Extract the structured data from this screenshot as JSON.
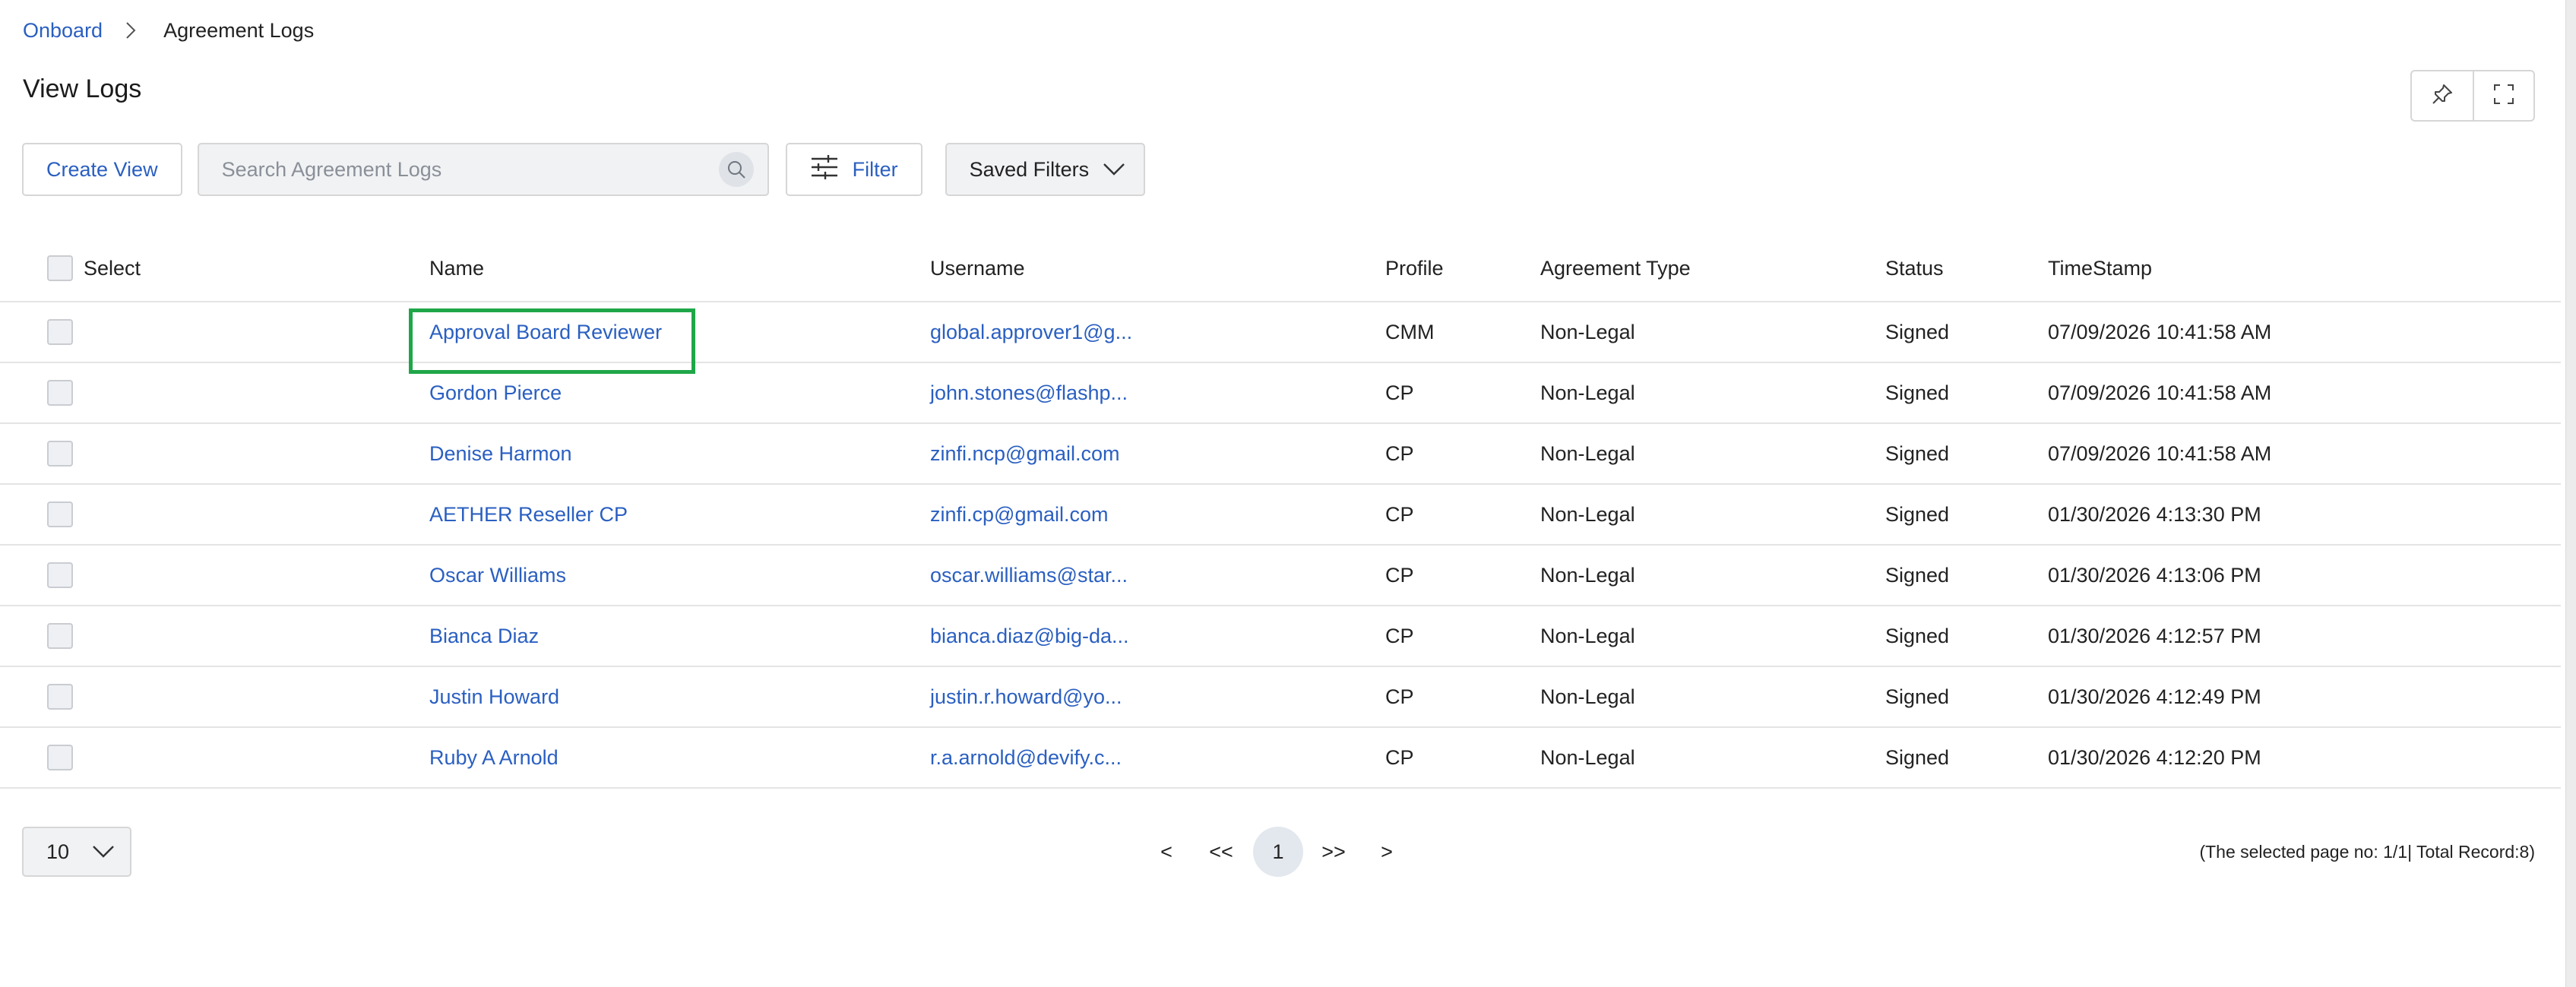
{
  "breadcrumb": {
    "parent": "Onboard",
    "current": "Agreement Logs"
  },
  "page_title": "View Logs",
  "toolbar": {
    "create_view": "Create View",
    "search_placeholder": "Search Agreement Logs",
    "filter": "Filter",
    "saved_filters": "Saved Filters"
  },
  "icons": {
    "pin": "pin-icon",
    "fullscreen": "fullscreen-icon",
    "search": "search-icon",
    "filter": "sliders-icon",
    "dropdown": "chevron-down-icon",
    "breadcrumb_separator": "chevron-right-icon"
  },
  "colors": {
    "link": "#2a5fc1",
    "highlight": "#1fa648"
  },
  "table": {
    "columns": {
      "select": "Select",
      "name": "Name",
      "username": "Username",
      "profile": "Profile",
      "agreement_type": "Agreement Type",
      "status": "Status",
      "timestamp": "TimeStamp"
    },
    "rows": [
      {
        "name": "Approval Board Reviewer",
        "username": "global.approver1@g...",
        "profile": "CMM",
        "agreement_type": "Non-Legal",
        "status": "Signed",
        "timestamp": "07/09/2026 10:41:58 AM"
      },
      {
        "name": "Gordon Pierce",
        "username": "john.stones@flashp...",
        "profile": "CP",
        "agreement_type": "Non-Legal",
        "status": "Signed",
        "timestamp": "07/09/2026 10:41:58 AM"
      },
      {
        "name": "Denise Harmon",
        "username": "zinfi.ncp@gmail.com",
        "profile": "CP",
        "agreement_type": "Non-Legal",
        "status": "Signed",
        "timestamp": "07/09/2026 10:41:58 AM"
      },
      {
        "name": "AETHER Reseller CP",
        "username": "zinfi.cp@gmail.com",
        "profile": "CP",
        "agreement_type": "Non-Legal",
        "status": "Signed",
        "timestamp": "01/30/2026 4:13:30 PM"
      },
      {
        "name": "Oscar Williams",
        "username": "oscar.williams@star...",
        "profile": "CP",
        "agreement_type": "Non-Legal",
        "status": "Signed",
        "timestamp": "01/30/2026 4:13:06 PM"
      },
      {
        "name": "Bianca Diaz",
        "username": "bianca.diaz@big-da...",
        "profile": "CP",
        "agreement_type": "Non-Legal",
        "status": "Signed",
        "timestamp": "01/30/2026 4:12:57 PM"
      },
      {
        "name": "Justin Howard",
        "username": "justin.r.howard@yo...",
        "profile": "CP",
        "agreement_type": "Non-Legal",
        "status": "Signed",
        "timestamp": "01/30/2026 4:12:49 PM"
      },
      {
        "name": "Ruby A Arnold",
        "username": "r.a.arnold@devify.c...",
        "profile": "CP",
        "agreement_type": "Non-Legal",
        "status": "Signed",
        "timestamp": "01/30/2026 4:12:20 PM"
      }
    ]
  },
  "pagination": {
    "page_size": "10",
    "prev": "<",
    "first": "<<",
    "current": "1",
    "last": ">>",
    "next": ">",
    "info": "(The selected page no: 1/1| Total Record:8)"
  }
}
